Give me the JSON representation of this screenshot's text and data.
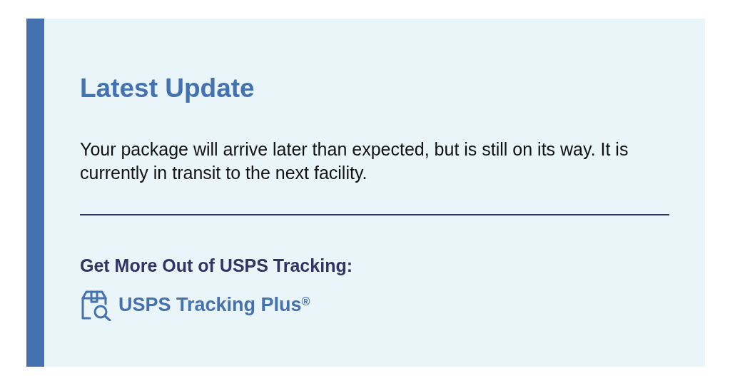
{
  "update": {
    "title": "Latest Update",
    "message": "Your package will arrive later than expected, but is still on its way. It is currently in transit to the next facility."
  },
  "more": {
    "heading": "Get More Out of USPS Tracking:",
    "link": "USPS Tracking Plus$^{®}$"
  }
}
